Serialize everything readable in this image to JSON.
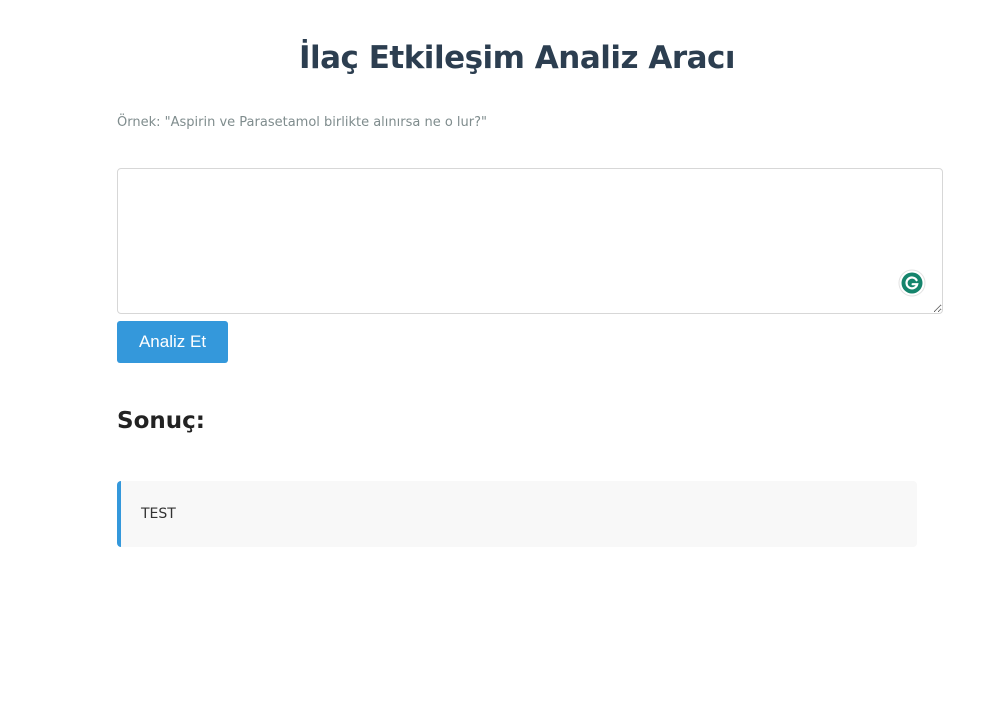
{
  "page": {
    "title": "İlaç Etkileşim Analiz Aracı",
    "example_text": "Örnek: \"Aspirin ve Parasetamol birlikte alınırsa ne o lur?\""
  },
  "form": {
    "textarea_value": "",
    "analyze_button_label": "Analiz Et"
  },
  "result": {
    "heading": "Sonuç:",
    "text": "TEST"
  },
  "colors": {
    "accent": "#3498db",
    "title": "#2c3e50",
    "muted": "#7f8c8d",
    "grammarly": "#15846c"
  },
  "icons": {
    "grammarly_badge": "grammarly-icon"
  }
}
